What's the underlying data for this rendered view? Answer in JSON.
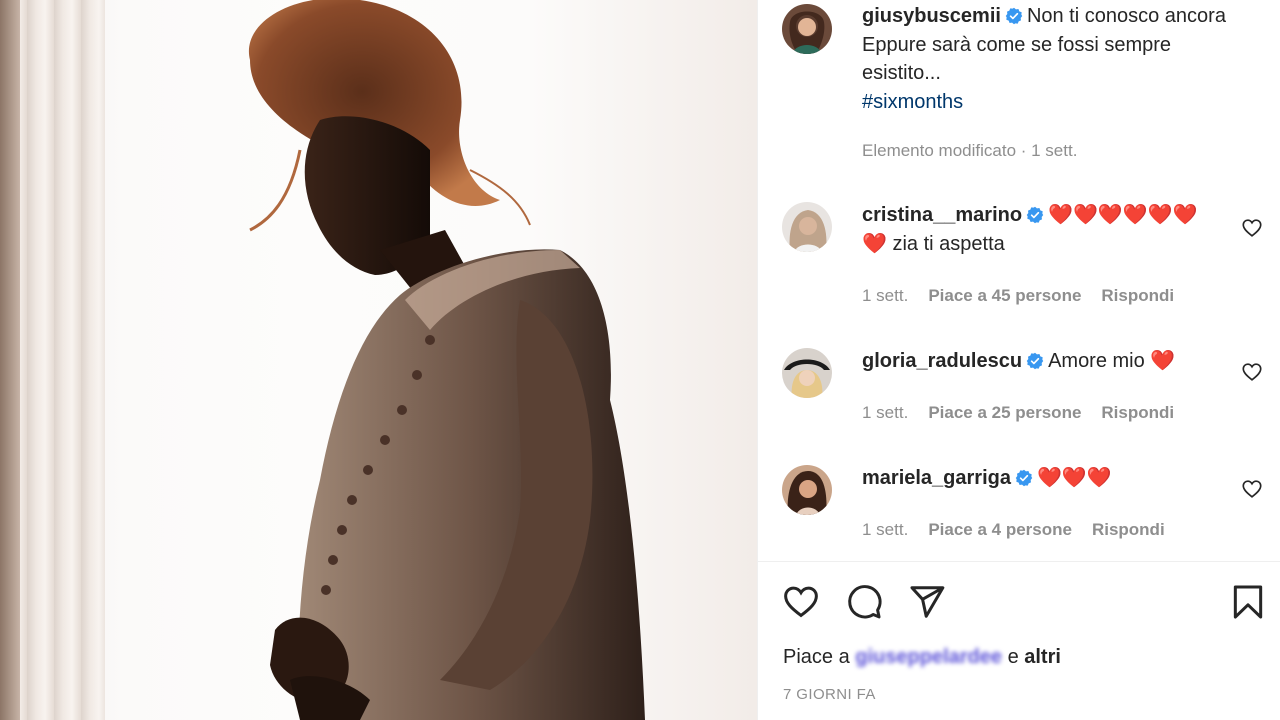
{
  "post": {
    "author": "giusybuscemii",
    "caption_line1": "Non ti conosco ancora",
    "caption_line2": "Eppure sarà come se fossi sempre",
    "caption_line3": "esistito...",
    "hashtag": "#sixmonths",
    "edited_meta": "Elemento modificato · 1 sett."
  },
  "comments": [
    {
      "user": "cristina__marino",
      "text_hearts": "❤️❤️❤️❤️❤️❤️",
      "text_line2": "❤️ zia ti aspetta",
      "time": "1 sett.",
      "likes": "Piace a 45 persone",
      "reply": "Rispondi"
    },
    {
      "user": "gloria_radulescu",
      "text": "Amore mio ❤️",
      "time": "1 sett.",
      "likes": "Piace a 25 persone",
      "reply": "Rispondi"
    },
    {
      "user": "mariela_garriga",
      "text": "❤️❤️❤️",
      "time": "1 sett.",
      "likes": "Piace a 4 persone",
      "reply": "Rispondi"
    }
  ],
  "footer": {
    "likes_prefix": "Piace a",
    "likes_name": "giuseppelardee",
    "likes_suffix": "e",
    "likes_others": "altri",
    "date": "7 GIORNI FA"
  },
  "icons": {
    "like": "heart-outline-icon",
    "comment": "speech-bubble-icon",
    "share": "paper-plane-icon",
    "save": "bookmark-icon",
    "verified": "verified-badge-icon",
    "comment_like": "heart-small-icon"
  },
  "colors": {
    "verified": "#3897f0",
    "link": "#00376b",
    "meta": "#8e8e8e",
    "heart": "#ed4956"
  }
}
